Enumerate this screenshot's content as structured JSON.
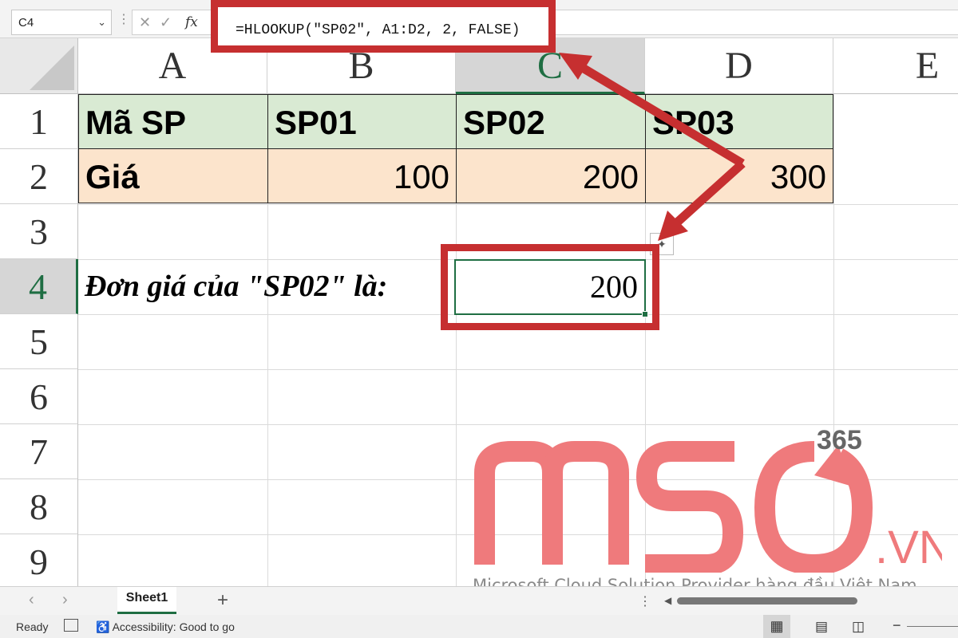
{
  "formula_bar": {
    "name_box": "C4",
    "fx_label": "fx",
    "formula": "=HLOOKUP(\"SP02\", A1:D2, 2, FALSE)"
  },
  "columns": [
    "A",
    "B",
    "C",
    "D",
    "E"
  ],
  "rows": [
    "1",
    "2",
    "3",
    "4",
    "5",
    "6",
    "7",
    "8",
    "9"
  ],
  "cells": {
    "A1": "Mã SP",
    "B1": "SP01",
    "C1": "SP02",
    "D1": "SP03",
    "A2": "Giá",
    "B2": "100",
    "C2": "200",
    "D2": "300",
    "A4": "Đơn giá của \"SP02\" là:",
    "C4": "200"
  },
  "watermark": {
    "brand": "MSO",
    "suffix": ".VN",
    "superscript": "365",
    "tagline": "Microsoft Cloud Solution Provider hàng đầu Việt Nam"
  },
  "sheet_tabs": {
    "active": "Sheet1",
    "add": "+"
  },
  "status_bar": {
    "ready": "Ready",
    "accessibility": "Accessibility: Good to go"
  },
  "colors": {
    "header_fill": "#d9ead3",
    "value_fill": "#fce4cc",
    "highlight_red": "#c62f30",
    "excel_green": "#1f6e43",
    "watermark_pink": "#ef7a7c"
  }
}
